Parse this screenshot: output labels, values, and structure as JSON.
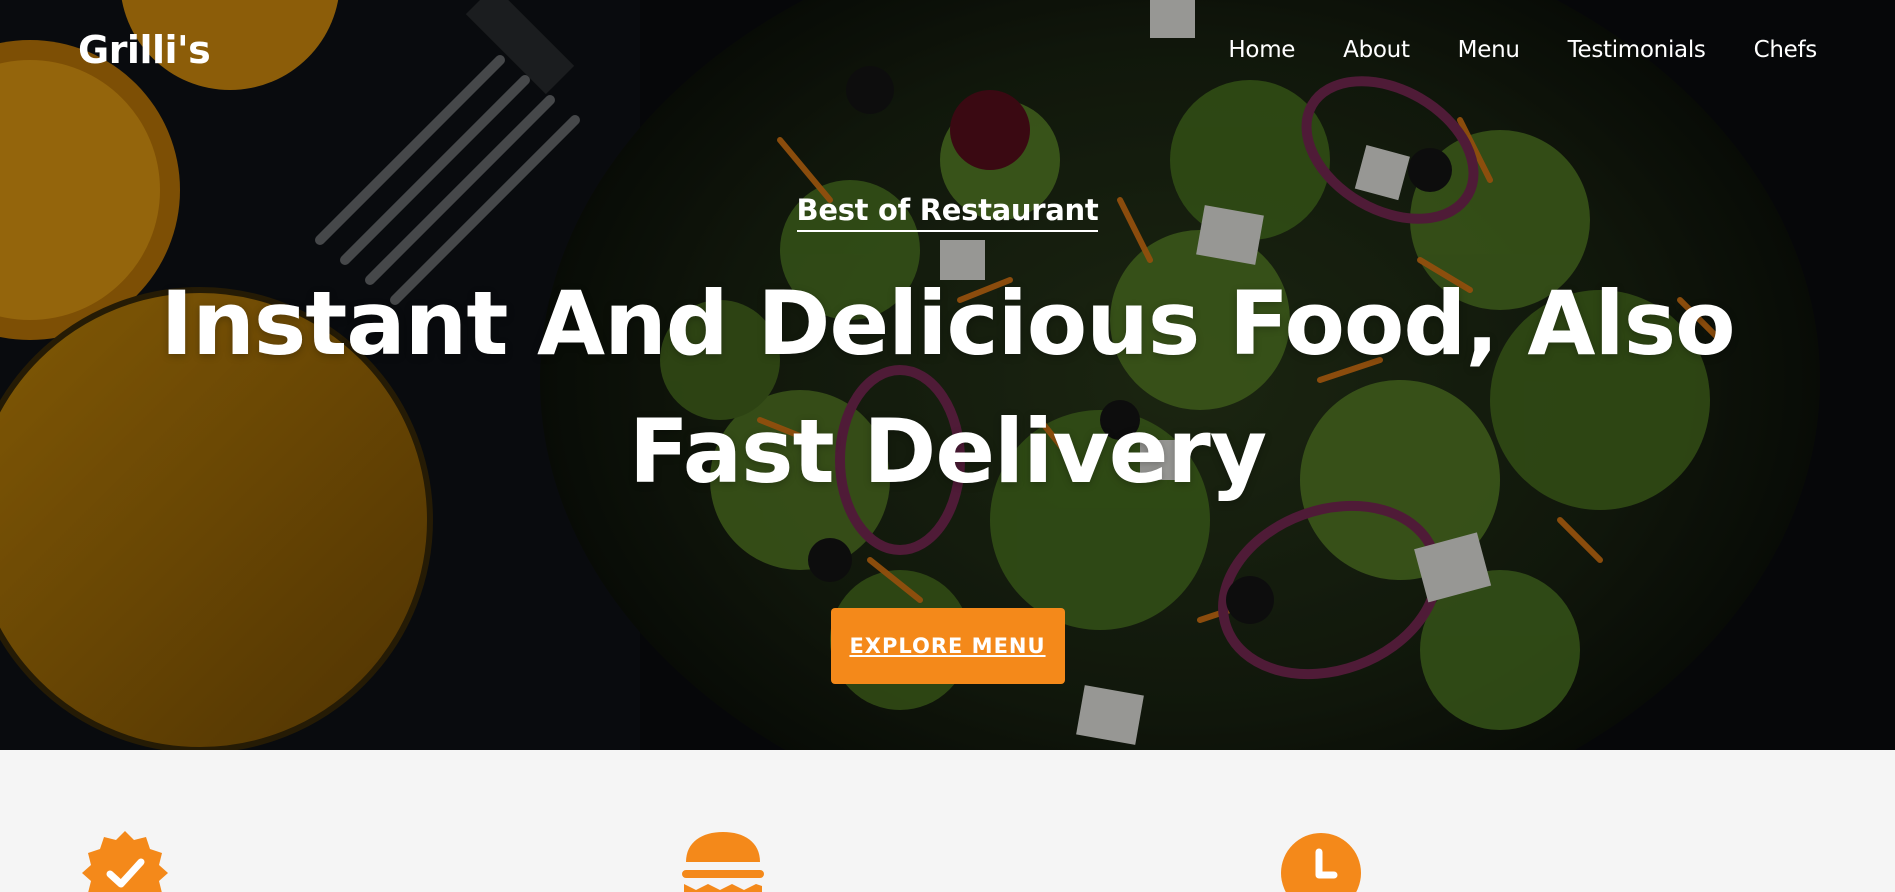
{
  "navbar": {
    "logo": "Grilli's",
    "links": [
      {
        "label": "Home"
      },
      {
        "label": "About"
      },
      {
        "label": "Menu"
      },
      {
        "label": "Testimonials"
      },
      {
        "label": "Chefs"
      }
    ]
  },
  "hero": {
    "subtitle": "Best of Restaurant",
    "headline": "Instant And Delicious Food, Also Fast Delivery",
    "cta_label": "EXPLORE MENU"
  },
  "features": {
    "items": [
      {
        "icon": "verified-badge-icon"
      },
      {
        "icon": "burger-icon"
      },
      {
        "icon": "clock-icon"
      }
    ]
  },
  "colors": {
    "accent": "#f4891a",
    "hero_text": "#ffffff",
    "page_bg": "#f5f5f5"
  }
}
